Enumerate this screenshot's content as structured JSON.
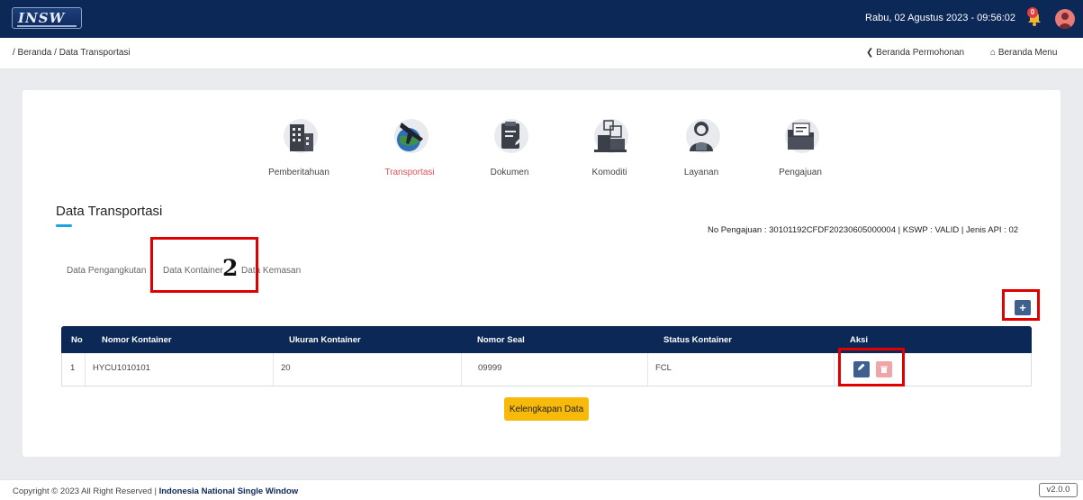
{
  "header": {
    "logo_text": "INSW",
    "datetime": "Rabu, 02 Agustus 2023 - 09:56:02",
    "notification_count": "0",
    "bell_icon": "bell-icon",
    "avatar_icon": "user-avatar-icon"
  },
  "breadcrumb": {
    "text": "/ Beranda / Data Transportasi",
    "back_label": "Beranda Permohonan",
    "back_icon": "chevron-left-icon",
    "menu_label": "Beranda Menu",
    "menu_icon": "home-icon"
  },
  "steps": [
    {
      "label": "Pemberitahuan",
      "icon": "building-icon"
    },
    {
      "label": "Transportasi",
      "icon": "airplane-globe-icon"
    },
    {
      "label": "Dokumen",
      "icon": "document-edit-icon"
    },
    {
      "label": "Komoditi",
      "icon": "boxes-icon"
    },
    {
      "label": "Layanan",
      "icon": "customer-service-icon"
    },
    {
      "label": "Pengajuan",
      "icon": "folder-icon"
    }
  ],
  "active_step": "Transportasi",
  "section": {
    "title": "Data Transportasi",
    "meta": "No Pengajuan : 30101192CFDF20230605000004 | KSWP : VALID | Jenis API : 02"
  },
  "tabs": [
    "Data Pengangkutan",
    "Data Kontainer",
    "Data Kemasan"
  ],
  "annotation_number": "2",
  "add_button": {
    "label": "+",
    "icon": "plus-icon"
  },
  "table": {
    "headers": [
      "No",
      "Nomor Kontainer",
      "Ukuran Kontainer",
      "Nomor Seal",
      "Status Kontainer",
      "Aksi"
    ],
    "rows": [
      {
        "no": "1",
        "nomor_kontainer": "HYCU1010101",
        "ukuran": "20",
        "nomor_seal": "09999",
        "status": "FCL"
      }
    ],
    "edit_icon": "pencil-icon",
    "delete_icon": "trash-icon"
  },
  "kelengkapan_label": "Kelengkapan Data",
  "footer": {
    "copyright_prefix": "Copyright © 2023 All Right Reserved |",
    "copyright_org": "Indonesia National Single Window",
    "version": "v2.0.0"
  },
  "colors": {
    "navy": "#0b2857",
    "active_step": "#e5525b",
    "accent_blue": "#1aa5e0",
    "button_yellow": "#f7b90a",
    "annotation_red": "#e00000"
  }
}
